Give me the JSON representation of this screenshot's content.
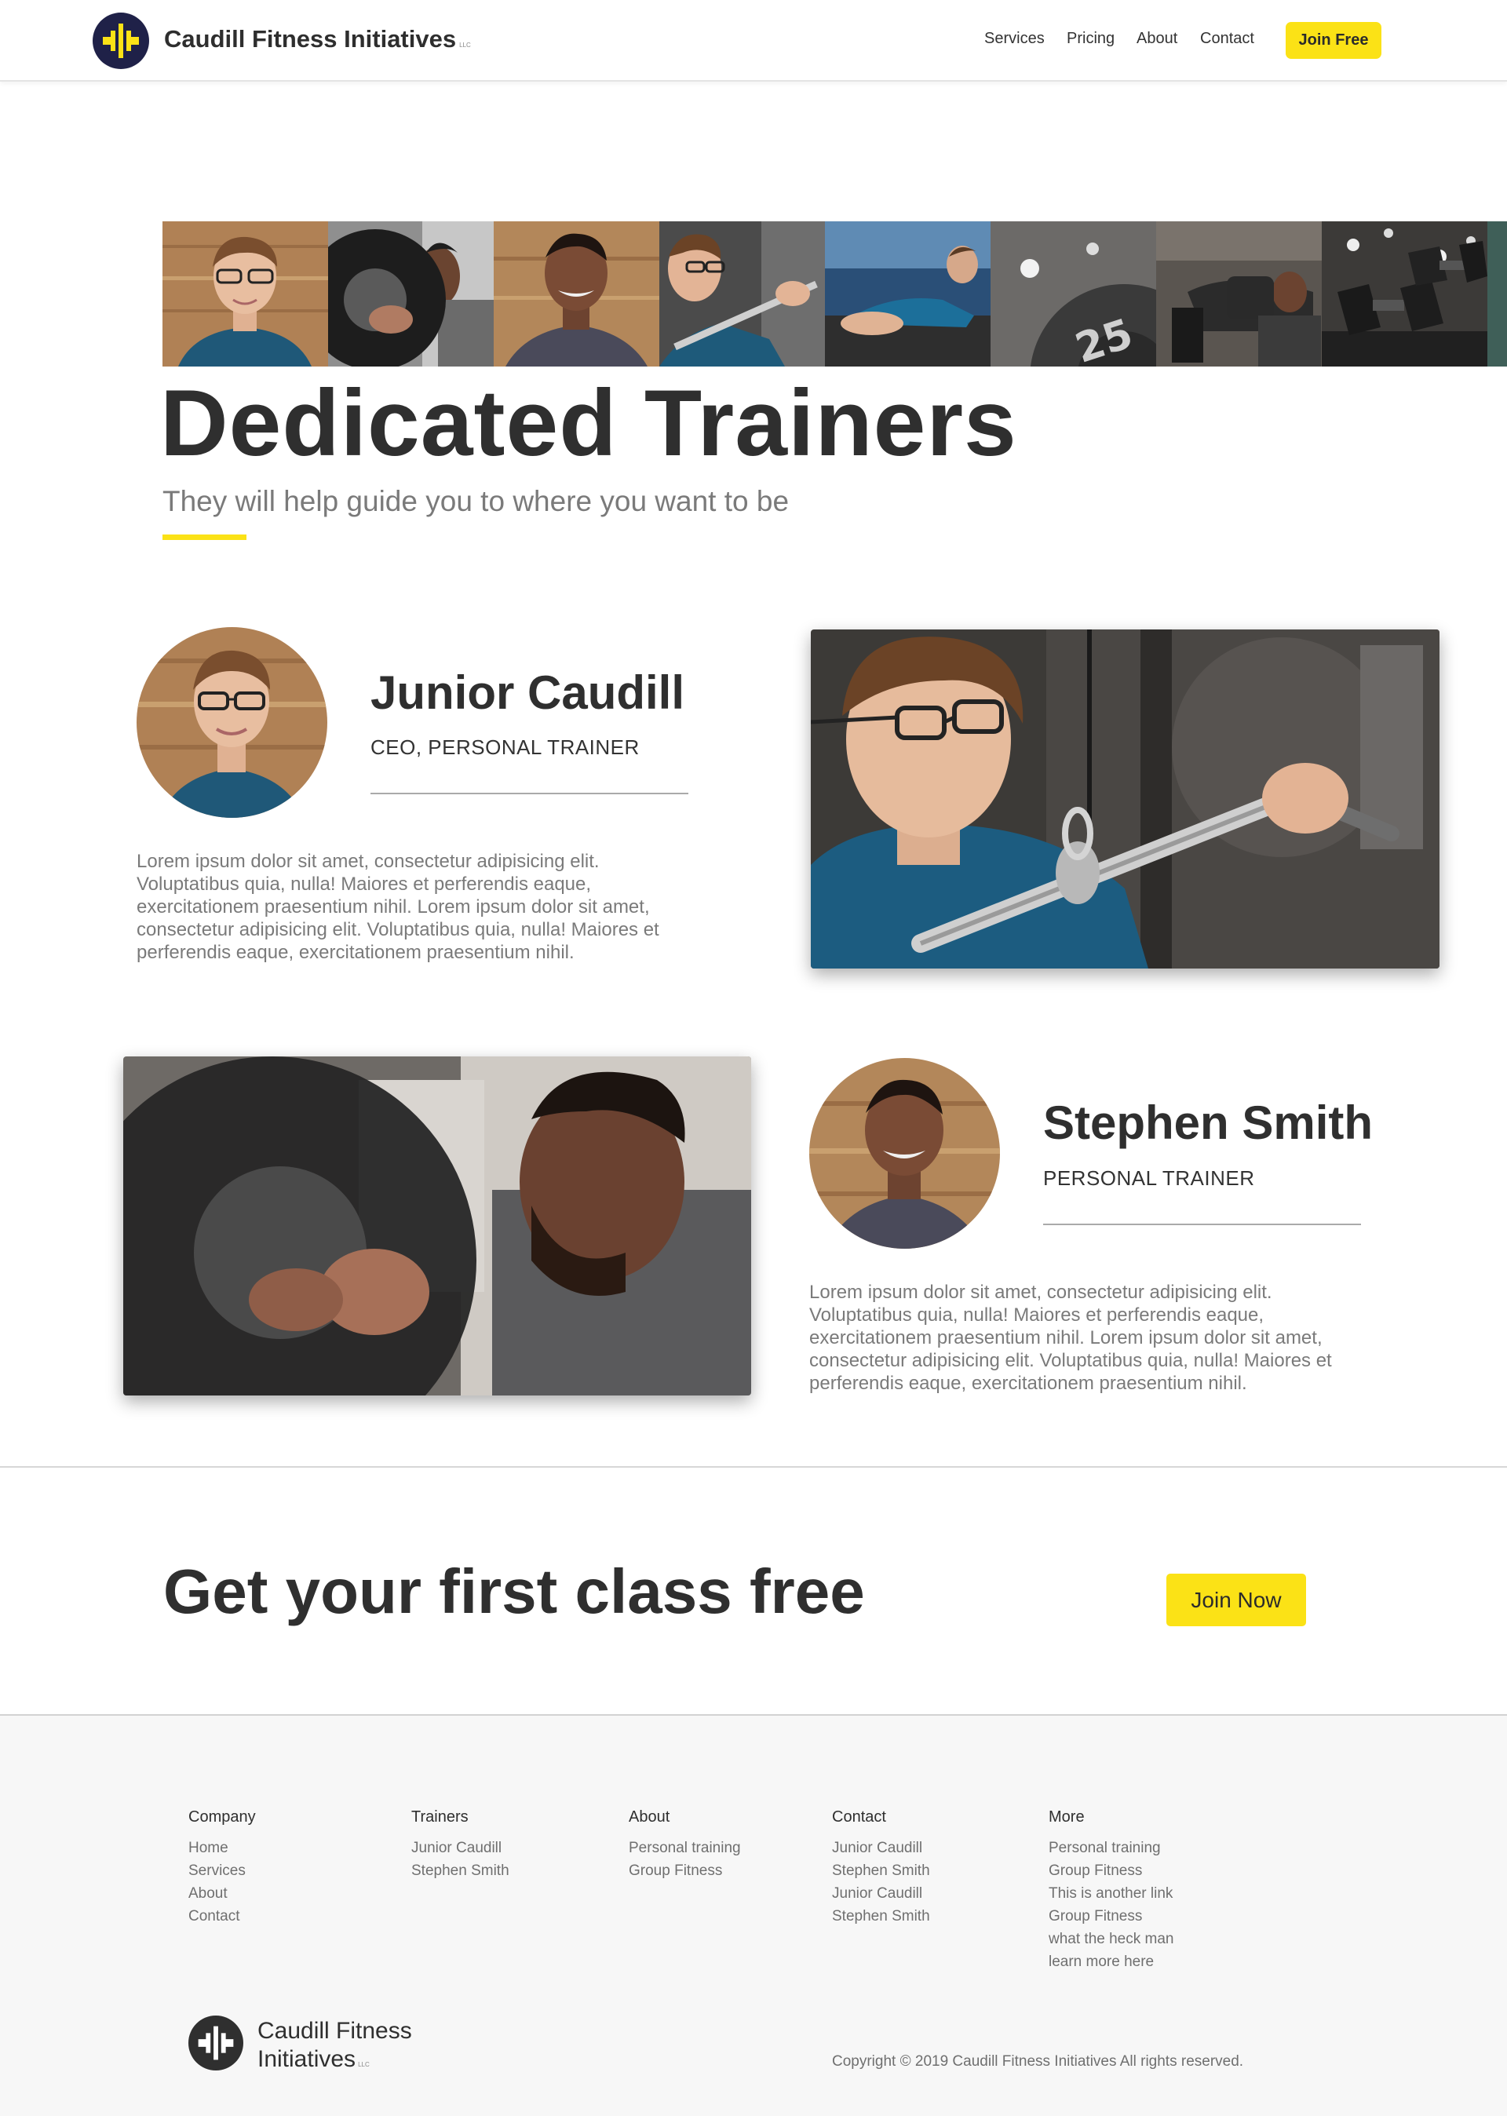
{
  "header": {
    "brand": "Caudill Fitness Initiatives",
    "brand_suffix": "LLC",
    "nav": [
      "Services",
      "Pricing",
      "About",
      "Contact"
    ],
    "cta": "Join Free"
  },
  "hero": {
    "title": "Dedicated Trainers",
    "subtitle": "They will help guide you to where you want to be"
  },
  "trainers": [
    {
      "name": "Junior Caudill",
      "role": "CEO, PERSONAL TRAINER",
      "bio": "Lorem ipsum dolor sit amet, consectetur adipisicing elit. Voluptatibus quia, nulla! Maiores et perferendis eaque, exercitationem praesentium nihil. Lorem ipsum dolor sit amet, consectetur adipisicing elit. Voluptatibus quia, nulla! Maiores et perferendis eaque, exercitationem praesentium nihil."
    },
    {
      "name": "Stephen Smith",
      "role": "PERSONAL TRAINER",
      "bio": "Lorem ipsum dolor sit amet, consectetur adipisicing elit. Voluptatibus quia, nulla! Maiores et perferendis eaque, exercitationem praesentium nihil. Lorem ipsum dolor sit amet, consectetur adipisicing elit. Voluptatibus quia, nulla! Maiores et perferendis eaque, exercitationem praesentium nihil."
    }
  ],
  "cta": {
    "title": "Get your first class free",
    "button": "Join Now"
  },
  "footer": {
    "columns": [
      {
        "title": "Company",
        "links": [
          "Home",
          "Services",
          "About",
          "Contact"
        ]
      },
      {
        "title": "Trainers",
        "links": [
          "Junior Caudill",
          "Stephen Smith"
        ]
      },
      {
        "title": "About",
        "links": [
          "Personal training",
          "Group Fitness"
        ]
      },
      {
        "title": "Contact",
        "links": [
          "Junior Caudill",
          "Stephen Smith",
          "Junior Caudill",
          "Stephen Smith"
        ]
      },
      {
        "title": "More",
        "links": [
          "Personal training",
          "Group Fitness",
          "This is another link",
          "Group Fitness",
          "what the heck man",
          "learn more here"
        ]
      }
    ],
    "brand_line1": "Caudill Fitness",
    "brand_line2": "Initiatives",
    "brand_suffix": "LLC",
    "copyright": "Copyright © 2019 Caudill Fitness Initiatives All rights reserved."
  },
  "colors": {
    "accent": "#fbe216",
    "logo_bg": "#1f2148",
    "text_dark": "#2f2f2f",
    "text_muted": "#7a7a7a"
  }
}
